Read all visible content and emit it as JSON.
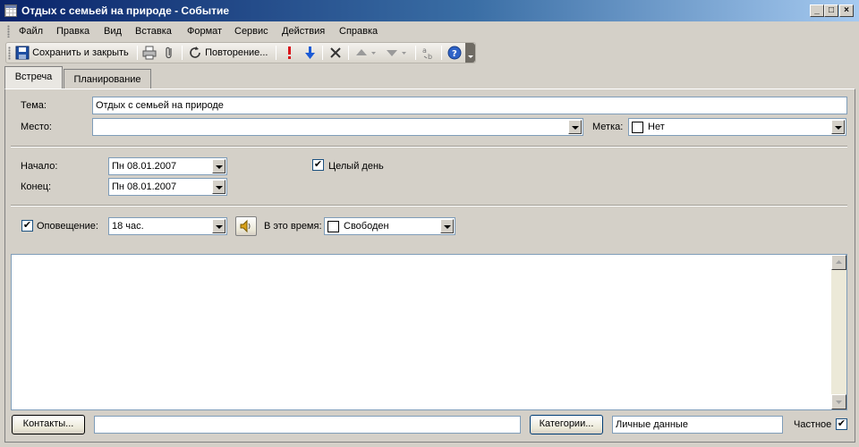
{
  "window": {
    "title": "Отдых с семьей на природе - Событие",
    "minimize_glyph": "_",
    "maximize_glyph": "□",
    "close_glyph": "×"
  },
  "menu": [
    "Файл",
    "Правка",
    "Вид",
    "Вставка",
    "Формат",
    "Сервис",
    "Действия",
    "Справка"
  ],
  "toolbar": {
    "save_close_label": "Сохранить и закрыть",
    "recurrence_label": "Повторение...",
    "icons": [
      "save-icon",
      "print-icon",
      "attach-icon",
      "recurrence-icon",
      "high-importance-icon",
      "low-importance-icon",
      "delete-icon",
      "previous-item-icon",
      "next-item-icon",
      "spelling-icon",
      "help-icon"
    ]
  },
  "tabs": [
    "Встреча",
    "Планирование"
  ],
  "form": {
    "subject_label": "Тема:",
    "subject_value": "Отдых с семьей на природе",
    "location_label": "Место:",
    "location_value": "",
    "label_label": "Метка:",
    "label_value": "Нет",
    "start_label": "Начало:",
    "start_date": "Пн 08.01.2007",
    "end_label": "Конец:",
    "end_date": "Пн 08.01.2007",
    "all_day_label": "Целый день",
    "all_day_checked": true,
    "reminder_label": "Оповещение:",
    "reminder_checked": true,
    "reminder_value": "18 час.",
    "show_time_as_label": "В это время:",
    "show_time_as_value": "Свободен",
    "notes": ""
  },
  "footer": {
    "contacts_button": "Контакты...",
    "contacts_value": "",
    "categories_button": "Категории...",
    "categories_value": "Личные данные",
    "private_label": "Частное",
    "private_checked": true
  },
  "colors": {
    "title_gradient_start": "#0a246a",
    "title_gradient_end": "#a6caf0",
    "face": "#d4d0c8"
  }
}
